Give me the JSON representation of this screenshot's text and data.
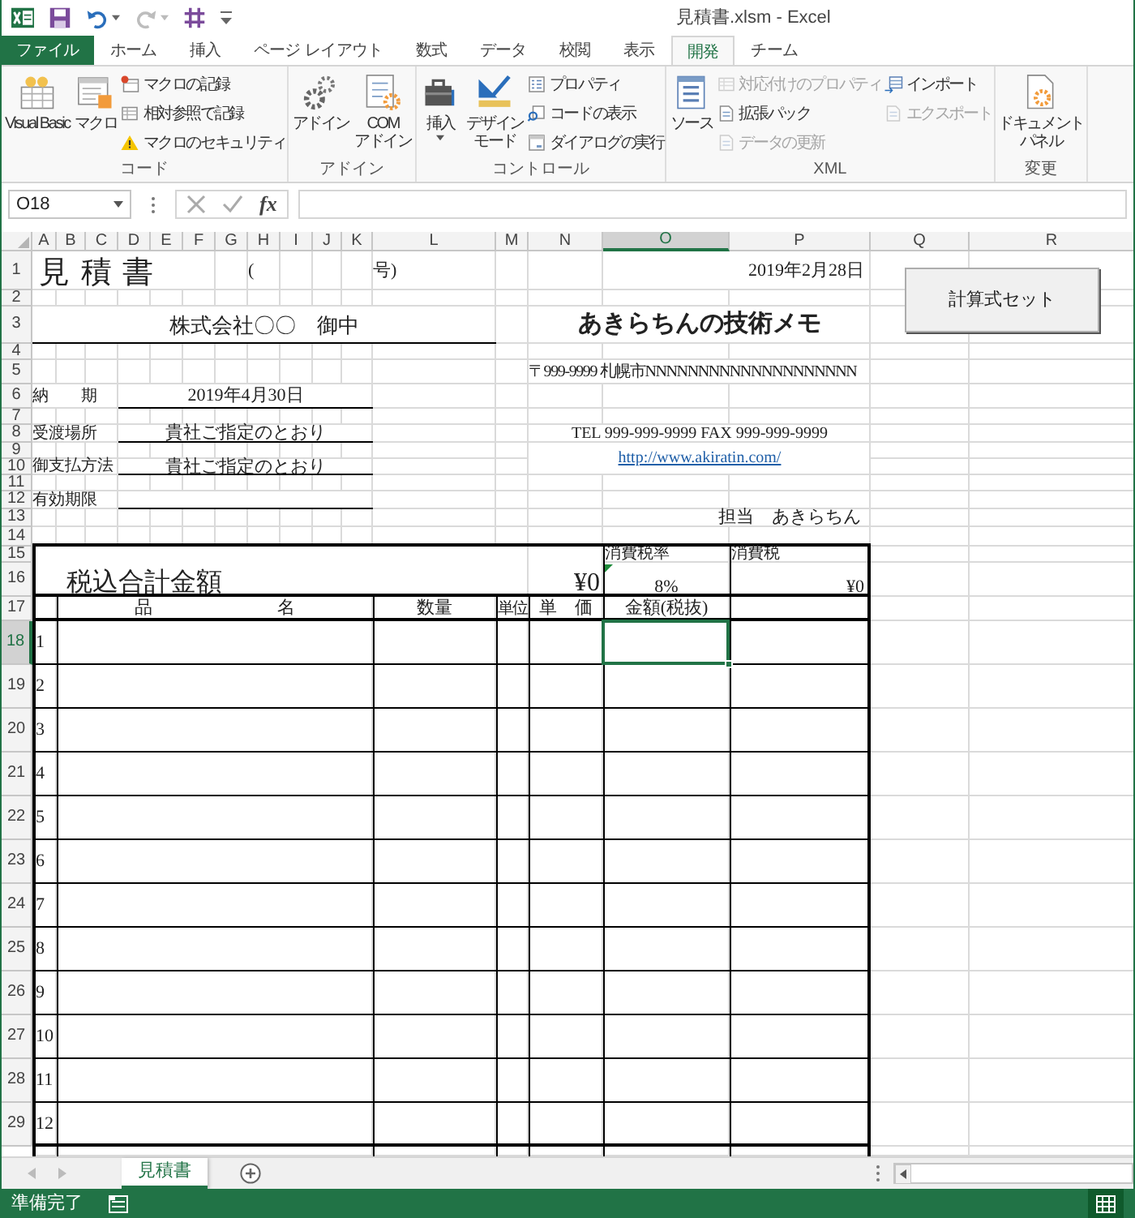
{
  "window": {
    "title": "見積書.xlsm - Excel"
  },
  "tabs": [
    {
      "label": "ファイル",
      "kind": "file",
      "selected": false
    },
    {
      "label": "ホーム",
      "kind": "tab",
      "selected": false
    },
    {
      "label": "挿入",
      "kind": "tab",
      "selected": false
    },
    {
      "label": "ページ レイアウト",
      "kind": "tab",
      "selected": false
    },
    {
      "label": "数式",
      "kind": "tab",
      "selected": false
    },
    {
      "label": "データ",
      "kind": "tab",
      "selected": false
    },
    {
      "label": "校閲",
      "kind": "tab",
      "selected": false
    },
    {
      "label": "表示",
      "kind": "tab",
      "selected": false
    },
    {
      "label": "開発",
      "kind": "tab",
      "selected": true
    },
    {
      "label": "チーム",
      "kind": "tab",
      "selected": false
    }
  ],
  "ribbon": {
    "groups": [
      {
        "label": "コード",
        "columns": [
          [
            {
              "kind": "large",
              "lines": [
                "Visual Basic"
              ],
              "dropdown": false
            }
          ],
          [
            {
              "kind": "large",
              "lines": [
                "マクロ"
              ],
              "dropdown": false
            }
          ],
          [
            {
              "kind": "small",
              "label": "マクロの記録",
              "disabled": false
            },
            {
              "kind": "small",
              "label": "相対参照で記録",
              "disabled": false
            },
            {
              "kind": "small",
              "label": "マクロのセキュリティ",
              "disabled": false
            }
          ]
        ]
      },
      {
        "label": "アドイン",
        "columns": [
          [
            {
              "kind": "large",
              "lines": [
                "アドイン"
              ],
              "dropdown": false
            }
          ],
          [
            {
              "kind": "large",
              "lines": [
                "COM",
                "アドイン"
              ],
              "dropdown": false
            }
          ]
        ]
      },
      {
        "label": "コントロール",
        "columns": [
          [
            {
              "kind": "large",
              "lines": [
                "挿入"
              ],
              "dropdown": true
            }
          ],
          [
            {
              "kind": "large",
              "lines": [
                "デザイン",
                "モード"
              ],
              "dropdown": false
            }
          ],
          [
            {
              "kind": "small",
              "label": "プロパティ",
              "disabled": false
            },
            {
              "kind": "small",
              "label": "コードの表示",
              "disabled": false
            },
            {
              "kind": "small",
              "label": "ダイアログの実行",
              "disabled": false
            }
          ]
        ]
      },
      {
        "label": "XML",
        "columns": [
          [
            {
              "kind": "large",
              "lines": [
                "ソース"
              ],
              "dropdown": false
            }
          ],
          [
            {
              "kind": "small",
              "label": "対応付けのプロパティ",
              "disabled": true
            },
            {
              "kind": "small",
              "label": "拡張パック",
              "disabled": false
            },
            {
              "kind": "small",
              "label": "データの更新",
              "disabled": true
            }
          ],
          [
            {
              "kind": "small",
              "label": "インポート",
              "disabled": false
            },
            {
              "kind": "small",
              "label": "エクスポート",
              "disabled": true
            }
          ]
        ]
      },
      {
        "label": "変更",
        "columns": [
          [
            {
              "kind": "large",
              "lines": [
                "ドキュメント",
                "パネル"
              ],
              "dropdown": false
            }
          ]
        ]
      }
    ]
  },
  "formula_bar": {
    "name_box": "O18",
    "function_button": "fx"
  },
  "sheet": {
    "columns": [
      {
        "label": "A",
        "selected": false
      },
      {
        "label": "B",
        "selected": false
      },
      {
        "label": "C",
        "selected": false
      },
      {
        "label": "D",
        "selected": false
      },
      {
        "label": "E",
        "selected": false
      },
      {
        "label": "F",
        "selected": false
      },
      {
        "label": "G",
        "selected": false
      },
      {
        "label": "H",
        "selected": false
      },
      {
        "label": "I",
        "selected": false
      },
      {
        "label": "J",
        "selected": false
      },
      {
        "label": "K",
        "selected": false
      },
      {
        "label": "L",
        "selected": false
      },
      {
        "label": "M",
        "selected": false
      },
      {
        "label": "N",
        "selected": false
      },
      {
        "label": "O",
        "selected": true
      },
      {
        "label": "P",
        "selected": false
      },
      {
        "label": "Q",
        "selected": false
      },
      {
        "label": "R",
        "selected": false
      }
    ],
    "rows": [
      {
        "label": "1",
        "selected": false,
        "cells": [
          "見 積 書",
          "(",
          "号)",
          "2019年2月28日"
        ]
      },
      {
        "label": "2",
        "selected": false
      },
      {
        "label": "3",
        "selected": false,
        "cells": [
          "株式会社〇〇　御中",
          "あきらちんの技術メモ"
        ]
      },
      {
        "label": "4",
        "selected": false
      },
      {
        "label": "5",
        "selected": false,
        "cells": [
          "〒999-9999 札幌市NNNNNNNNNNNNNNNNNNNN"
        ]
      },
      {
        "label": "6",
        "selected": false,
        "cells": [
          "納　　期",
          "2019年4月30日"
        ]
      },
      {
        "label": "7",
        "selected": false
      },
      {
        "label": "8",
        "selected": false,
        "cells": [
          "受渡場所",
          "貴社ご指定のとおり",
          "TEL  999-999-9999  FAX  999-999-9999"
        ]
      },
      {
        "label": "9",
        "selected": false,
        "cells": [
          "http://www.akiratin.com/"
        ]
      },
      {
        "label": "10",
        "selected": false,
        "cells": [
          "御支払方法",
          "貴社ご指定のとおり"
        ]
      },
      {
        "label": "11",
        "selected": false
      },
      {
        "label": "12",
        "selected": false,
        "cells": [
          "有効期限"
        ]
      },
      {
        "label": "13",
        "selected": false,
        "cells": [
          "担当　あきらちん"
        ]
      },
      {
        "label": "14",
        "selected": false
      },
      {
        "label": "15",
        "selected": false,
        "cells": [
          "消費税率",
          "消費税"
        ]
      },
      {
        "label": "16",
        "selected": false,
        "cells": [
          "税込合計金額",
          "¥0",
          "8%",
          "¥0"
        ]
      },
      {
        "label": "17",
        "selected": false,
        "cells": [
          "品　　　　　　　名",
          "数量",
          "単位",
          "単　価",
          "金額(税抜)"
        ]
      },
      {
        "label": "18",
        "selected": true,
        "cells": [
          "1"
        ]
      },
      {
        "label": "19",
        "selected": false,
        "cells": [
          "2"
        ]
      },
      {
        "label": "20",
        "selected": false,
        "cells": [
          "3"
        ]
      },
      {
        "label": "21",
        "selected": false,
        "cells": [
          "4"
        ]
      },
      {
        "label": "22",
        "selected": false,
        "cells": [
          "5"
        ]
      },
      {
        "label": "23",
        "selected": false,
        "cells": [
          "6"
        ]
      },
      {
        "label": "24",
        "selected": false,
        "cells": [
          "7"
        ]
      },
      {
        "label": "25",
        "selected": false,
        "cells": [
          "8"
        ]
      },
      {
        "label": "26",
        "selected": false,
        "cells": [
          "9"
        ]
      },
      {
        "label": "27",
        "selected": false,
        "cells": [
          "10"
        ]
      },
      {
        "label": "28",
        "selected": false,
        "cells": [
          "11"
        ]
      },
      {
        "label": "29",
        "selected": false,
        "cells": [
          "12"
        ]
      }
    ]
  },
  "buttons": [
    {
      "label": "計算式セット"
    }
  ],
  "sheet_tabs": [
    {
      "label": "見積書",
      "selected": true
    }
  ],
  "status_bar": {
    "text": "準備完了"
  }
}
